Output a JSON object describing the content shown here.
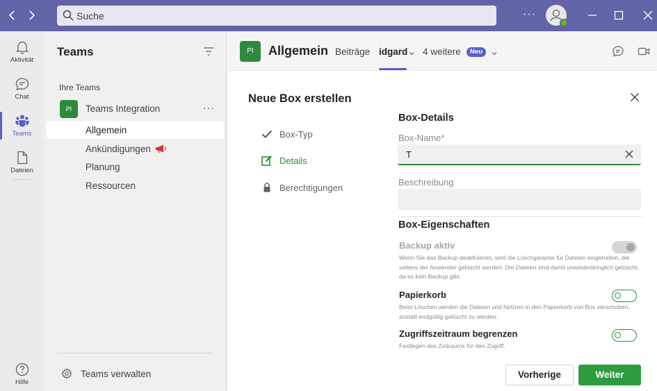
{
  "titlebar": {
    "search_placeholder": "Suche",
    "more": "···"
  },
  "rail": {
    "items": [
      {
        "label": "Aktivität",
        "icon": "bell-icon"
      },
      {
        "label": "Chat",
        "icon": "chat-icon"
      },
      {
        "label": "Teams",
        "icon": "teams-icon",
        "active": true
      },
      {
        "label": "Dateien",
        "icon": "file-icon"
      }
    ],
    "help": {
      "label": "Hilfe",
      "icon": "help-icon"
    }
  },
  "teams_panel": {
    "title": "Teams",
    "section": "Ihre Teams",
    "team": {
      "initials": "PI",
      "name": "Teams Integration",
      "more": "···"
    },
    "channels": [
      {
        "label": "Allgemein",
        "active": true
      },
      {
        "label": "Ankündigungen"
      },
      {
        "label": "Planung"
      },
      {
        "label": "Ressourcen"
      }
    ],
    "manage": "Teams verwalten"
  },
  "channel_header": {
    "initials": "PI",
    "title": "Allgemein",
    "tabs": [
      "Beiträge",
      "idgard",
      "4 weitere"
    ],
    "new_badge": "Neu"
  },
  "dialog": {
    "title": "Neue Box erstellen",
    "steps": [
      {
        "label": "Box-Typ",
        "state": "done"
      },
      {
        "label": "Details",
        "state": "active"
      },
      {
        "label": "Berechtigungen",
        "state": "locked"
      }
    ],
    "details_title": "Box-Details",
    "name_label": "Box-Name*",
    "name_value": "T",
    "description_label": "Beschreibung",
    "description_value": "",
    "properties_title": "Box-Eigenschaften",
    "properties": [
      {
        "name": "Backup aktiv",
        "description": "Wenn Sie das Backup deaktivieren, wird die Löschgarantie für Dateien eingehalten, die seitens der Anwender gelöscht werden. Die Dateien sind damit unwiederbringlich gelöscht, da es kein Backup gibt.",
        "state": "disabled-on"
      },
      {
        "name": "Papierkorb",
        "description": "Beim Löschen werden die Dateien und Notizen in den Papierkorb von Box verschoben, anstatt endgültig gelöscht zu werden.",
        "state": "off"
      },
      {
        "name": "Zugriffszeitraum begrenzen",
        "description": "Festlegen des Zeitraums für den Zugriff.",
        "state": "off"
      }
    ],
    "btn_previous": "Vorherige",
    "btn_next": "Weiter"
  },
  "colors": {
    "titlebar": "#6264a7",
    "accent": "#5b5fc7",
    "green": "#2e8b3d",
    "primary_button": "#2e9b3f"
  }
}
